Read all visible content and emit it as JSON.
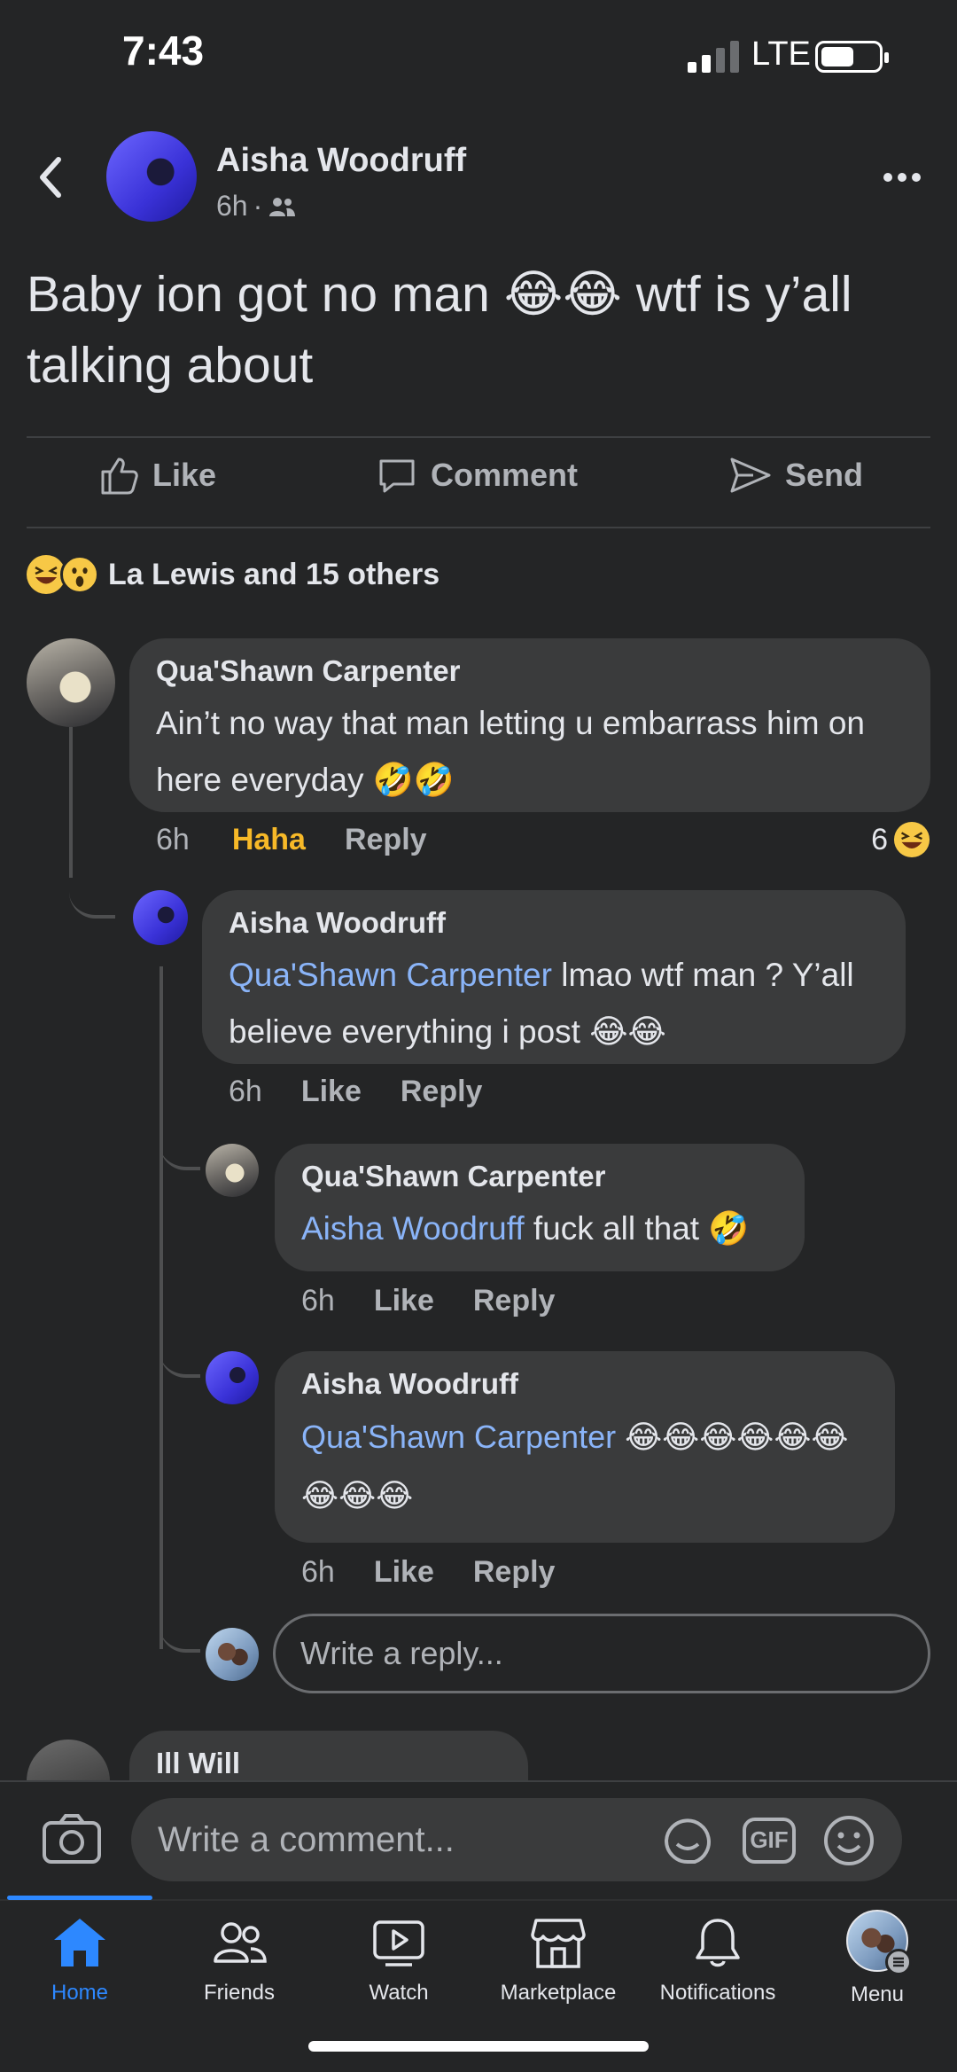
{
  "status_bar": {
    "time": "7:43",
    "network": "LTE"
  },
  "post": {
    "author": "Aisha Woodruff",
    "time": "6h",
    "audience_icon": "friends-icon",
    "text": "Baby ion got no man 😂😂 wtf is y’all talking about",
    "actions": {
      "like": "Like",
      "comment": "Comment",
      "send": "Send"
    },
    "reactions_summary": "La Lewis and 15 others"
  },
  "comments": [
    {
      "author": "Qua'Shawn Carpenter",
      "text": "Ain’t no way that man letting u embarrass him on here everyday 🤣🤣",
      "time": "6h",
      "reaction_label": "Haha",
      "reply_label": "Reply",
      "reaction_count": "6"
    },
    {
      "author": "Aisha Woodruff",
      "mention": "Qua'Shawn Carpenter",
      "text": " lmao wtf man ? Y’all believe everything i post 😂😂",
      "time": "6h",
      "like_label": "Like",
      "reply_label": "Reply"
    },
    {
      "author": "Qua'Shawn Carpenter",
      "mention": "Aisha Woodruff",
      "text": " fuck all that 🤣",
      "time": "6h",
      "like_label": "Like",
      "reply_label": "Reply"
    },
    {
      "author": "Aisha Woodruff",
      "mention": "Qua'Shawn Carpenter",
      "text": " 😂😂😂😂😂😂😂😂😂",
      "time": "6h",
      "like_label": "Like",
      "reply_label": "Reply"
    }
  ],
  "reply_placeholder": "Write a reply...",
  "next_comment_author": "Ill Will",
  "composer": {
    "placeholder": "Write a comment...",
    "gif_label": "GIF"
  },
  "tabs": [
    {
      "label": "Home",
      "icon": "home-icon",
      "active": true
    },
    {
      "label": "Friends",
      "icon": "friends-icon"
    },
    {
      "label": "Watch",
      "icon": "watch-icon"
    },
    {
      "label": "Marketplace",
      "icon": "marketplace-icon"
    },
    {
      "label": "Notifications",
      "icon": "bell-icon"
    },
    {
      "label": "Menu",
      "icon": "profile-avatar"
    }
  ],
  "colors": {
    "background": "#242526",
    "bubble": "#3a3b3c",
    "mention": "#8ab4f8",
    "haha": "#f7b928",
    "active_tab": "#2d88ff"
  }
}
